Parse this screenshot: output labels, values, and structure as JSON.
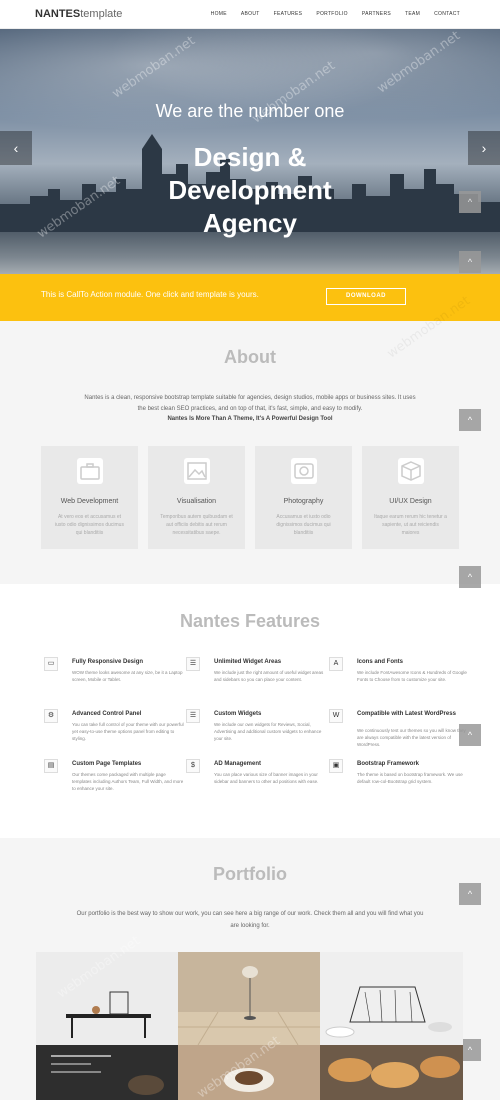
{
  "nav": {
    "logo_bold": "NANTES",
    "logo_light": "template",
    "menu": [
      "HOME",
      "ABOUT",
      "FEATURES",
      "PORTFOLIO",
      "PARTNERS",
      "TEAM",
      "CONTACT"
    ]
  },
  "hero": {
    "line1": "We are the number one",
    "title": "Design & Development Agency",
    "prev": "‹",
    "next": "›"
  },
  "cta": {
    "text": "This is CallTo Action module. One click and template is yours.",
    "button": "DOWNLOAD"
  },
  "about": {
    "title": "About",
    "text": "Nantes is a clean, responsive bootstrap template suitable for agencies, design studios, mobile apps or business sites. It uses the best clean SEO practices, and on top of that, it's fast, simple, and easy to modify.",
    "bold": "Nantes Is More Than A Theme, It's A Powerful Design Tool",
    "cards": [
      {
        "title": "Web Development",
        "text": "At vero eos et accusamus et iusto odio dignissimos ducimus qui blanditiis"
      },
      {
        "title": "Visualisation",
        "text": "Temporibus autem quibusdam et aut officiis debitis aut rerum necessitatibus saepe."
      },
      {
        "title": "Photography",
        "text": "Accusamus et iusto odio dignissimos ducimus qui blanditiis"
      },
      {
        "title": "UI/UX Design",
        "text": "Itaque earum rerum hic tenetur a sapiente, ut aut reiciendis maiores"
      }
    ]
  },
  "features": {
    "title": "Nantes Features",
    "items": [
      {
        "title": "Fully Responsive Design",
        "text": "WOW theme looks awesome at any size, be it a Laptop screen, Mobile or Tablet.",
        "icon": "▭"
      },
      {
        "title": "Unlimited Widget Areas",
        "text": "We include just the right amount of useful widget areas and sidebars so you can place your content.",
        "icon": "☰"
      },
      {
        "title": "Icons and Fonts",
        "text": "We include FontAwesome Icons & Hundreds of Google Fonts to Choose from to customize your site.",
        "icon": "A"
      },
      {
        "title": "Advanced Control Panel",
        "text": "You can take full control of your theme with our powerful yet easy-to-use theme options panel from editing to styling.",
        "icon": "⚙"
      },
      {
        "title": "Custom Widgets",
        "text": "We include our own widgets for Reviews, Social, Advertising and additional custom widgets to enhance your site.",
        "icon": "☰"
      },
      {
        "title": "Compatible with Latest WordPress",
        "text": "We continuously test our themes so you will know they are always compatible with the latest version of WordPress.",
        "icon": "W"
      },
      {
        "title": "Custom Page Templates",
        "text": "Our themes come packaged with multiple page templates including Authors Team, Full Width, and more to enhance your site.",
        "icon": "▤"
      },
      {
        "title": "AD Management",
        "text": "You can place various size of banner images in your sidebar and banners to other ad positions with ease.",
        "icon": "$"
      },
      {
        "title": "Bootstrap Framework",
        "text": "The theme is based on bootstrap framework. We use default row-col-Bootstrap grid system.",
        "icon": "▣"
      }
    ]
  },
  "portfolio": {
    "title": "Portfolio",
    "text": "Our portfolio is the best way to show our work, you can see here a big range of our work. Check them all and you will find what you are looking for."
  },
  "scrolltop_icon": "^",
  "watermark": "webmoban.net",
  "colors": {
    "accent": "#fcc10f",
    "section_bg": "#f5f5f5",
    "card_bg": "#e9e9e9"
  }
}
